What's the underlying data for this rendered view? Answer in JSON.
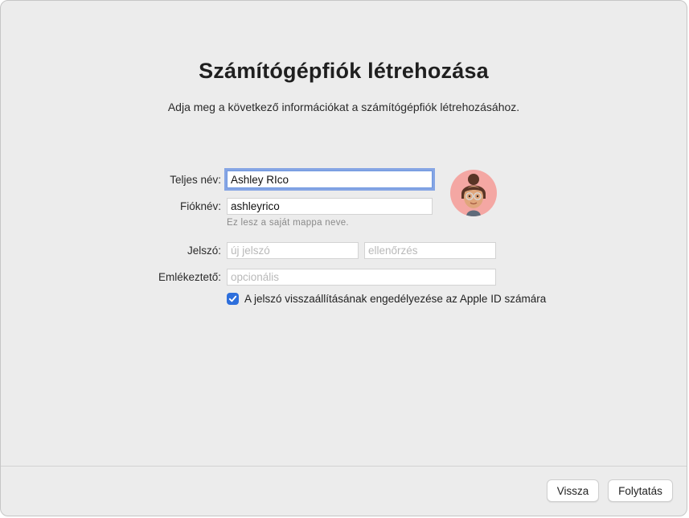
{
  "header": {
    "title": "Számítógépfiók létrehozása",
    "subtitle": "Adja meg a következő információkat a számítógépfiók létrehozásához."
  },
  "form": {
    "full_name": {
      "label": "Teljes név:",
      "value": "Ashley RIco"
    },
    "account_name": {
      "label": "Fióknév:",
      "value": "ashleyrico",
      "hint": "Ez lesz a saját mappa neve."
    },
    "password": {
      "label": "Jelszó:",
      "placeholder": "új jelszó",
      "verify_placeholder": "ellenőrzés"
    },
    "hint_field": {
      "label": "Emlékeztető:",
      "placeholder": "opcionális"
    },
    "apple_id_reset": {
      "label": "A jelszó visszaállításának engedélyezése az Apple ID számára",
      "checked": true
    }
  },
  "avatar": {
    "icon": "memoji-avatar-icon",
    "background": "#f4a7a3"
  },
  "footer": {
    "back_label": "Vissza",
    "continue_label": "Folytatás"
  },
  "colors": {
    "accent": "#2e6fdc",
    "focus_ring": "#6f97e0"
  }
}
